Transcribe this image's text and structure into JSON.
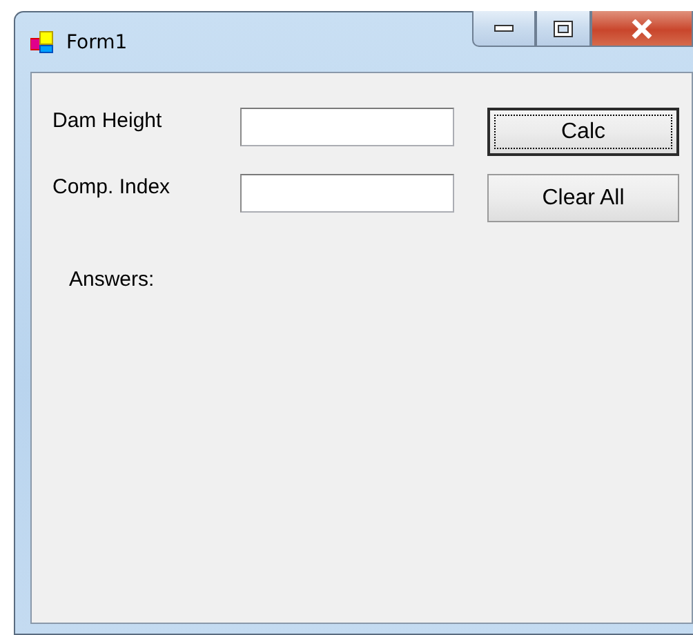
{
  "window": {
    "title": "Form1"
  },
  "fields": [
    {
      "label": "Dam Height"
    },
    {
      "label": "Comp. Index"
    }
  ],
  "buttons": [
    {
      "label": "Calc",
      "focused": true
    },
    {
      "label": "Clear All",
      "focused": false
    }
  ],
  "answers_label": "Answers:"
}
